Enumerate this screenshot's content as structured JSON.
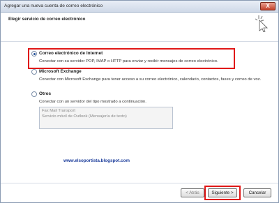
{
  "window": {
    "title": "Agregar una nueva cuenta de correo electrónico",
    "close_glyph": "X"
  },
  "header": {
    "title": "Elegir servicio de correo electrónico"
  },
  "options": [
    {
      "label": "Correo electrónico de Internet",
      "description": "Conectar con su servidor POP, IMAP o HTTP para enviar y recibir mensajes de correo electrónico.",
      "selected": true
    },
    {
      "label": "Microsoft Exchange",
      "description": "Conectar con Microsoft Exchange para tener acceso a su correo electrónico, calendario, contactos, faxes y correo de voz.",
      "selected": false
    },
    {
      "label": "Otros",
      "description": "Conectar con un servidor del tipo mostrado a continuación.",
      "selected": false
    }
  ],
  "transports": [
    "Fax Mail Transport",
    "Servicio móvil de Outlook (Mensajería de texto)"
  ],
  "watermark": "www.elsoportista.blogspot.com",
  "buttons": {
    "back": "< Atrás",
    "next": "Siguiente >",
    "cancel": "Cancelar"
  },
  "colors": {
    "highlight": "#e01818",
    "watermark": "#1b3c9b"
  }
}
